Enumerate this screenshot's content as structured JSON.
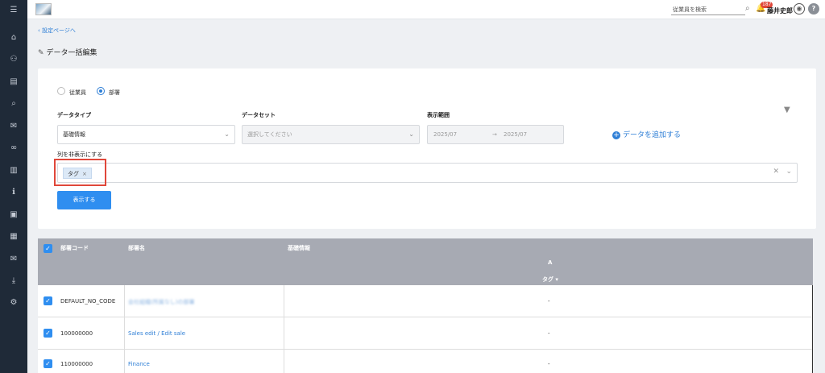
{
  "sidebar": {
    "items": [
      {
        "icon": "menu-icon",
        "glyph": "☰"
      },
      {
        "icon": "home-icon",
        "glyph": "⌂"
      },
      {
        "icon": "org-chart-icon",
        "glyph": "⚇"
      },
      {
        "icon": "document-icon",
        "glyph": "▤"
      },
      {
        "icon": "search-icon",
        "glyph": "⌕"
      },
      {
        "icon": "chat-icon",
        "glyph": "✉"
      },
      {
        "icon": "link-icon",
        "glyph": "∞"
      },
      {
        "icon": "chart-icon",
        "glyph": "▥"
      },
      {
        "icon": "info-icon",
        "glyph": "ℹ"
      },
      {
        "icon": "contact-icon",
        "glyph": "▣"
      },
      {
        "icon": "book-icon",
        "glyph": "▦"
      },
      {
        "icon": "mail-icon",
        "glyph": "✉"
      },
      {
        "icon": "download-icon",
        "glyph": "⤓"
      },
      {
        "icon": "user-settings-icon",
        "glyph": "⚙"
      }
    ]
  },
  "header": {
    "search_placeholder": "従業員を検索",
    "notification_count": "187",
    "user_name": "藤井史郎",
    "help_glyph": "?"
  },
  "breadcrumb": {
    "back_label": "設定ページへ"
  },
  "page": {
    "title": "データ一括編集"
  },
  "form": {
    "radio_employee": "従業員",
    "radio_department": "部署",
    "data_type_label": "データタイプ",
    "data_type_value": "基礎情報",
    "dataset_label": "データセット",
    "dataset_placeholder": "選択してください",
    "range_label": "表示範囲",
    "range_from": "2025/07",
    "range_arrow": "→",
    "range_to": "2025/07",
    "add_data_label": "データを追加する",
    "hide_columns_label": "列を非表示にする",
    "tag_chip": "タグ",
    "show_button": "表示する"
  },
  "table": {
    "headers": {
      "code": "部署コード",
      "name": "部署名",
      "basic_info": "基礎情報",
      "group": "A",
      "tag": "タグ ▾"
    },
    "rows": [
      {
        "code": "DEFAULT_NO_CODE",
        "name": "会社組織(所属なし)の部署",
        "tag": "-",
        "blurred": true
      },
      {
        "code": "100000000",
        "name": "Sales edit / Edit sale",
        "tag": "-",
        "blurred": false
      },
      {
        "code": "110000000",
        "name": "Finance",
        "tag": "-",
        "blurred": false
      }
    ]
  }
}
